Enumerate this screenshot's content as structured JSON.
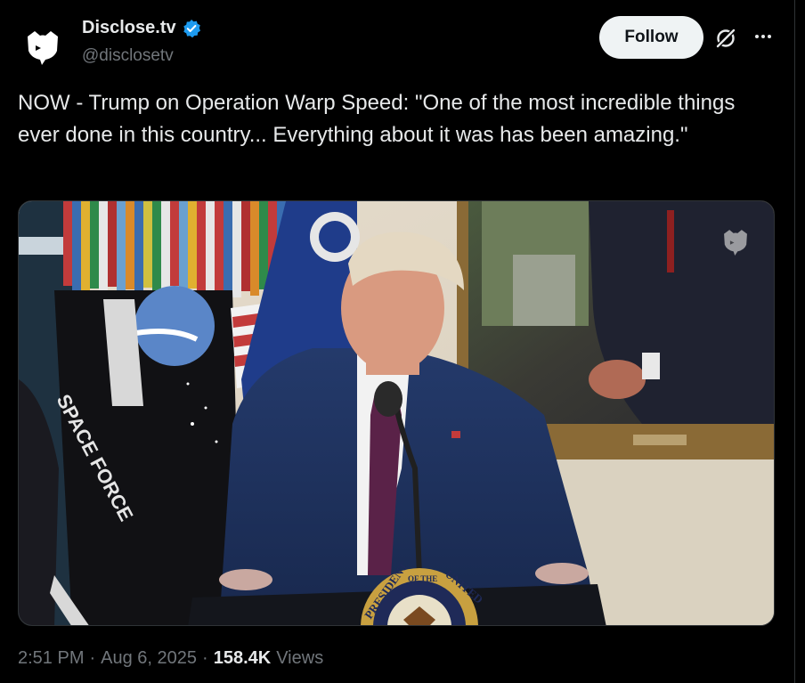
{
  "author": {
    "display_name": "Disclose.tv",
    "handle": "@disclosetv",
    "verified": true,
    "verified_color": "#1d9bf0"
  },
  "actions": {
    "follow_label": "Follow",
    "grok_icon": "grok-icon",
    "more_icon": "more-options-icon"
  },
  "tweet": {
    "text": "NOW - Trump on Operation Warp Speed: \"One of the most incredible things ever done in this country... Everything about it was has been amazing.\""
  },
  "media": {
    "type": "video-still",
    "flag_text": "SPACE FORCE",
    "seal_text_left": "PRESIDENT",
    "seal_text_mid": "OF THE",
    "seal_text_right": "UNITED"
  },
  "meta": {
    "time": "2:51 PM",
    "separator": "·",
    "date": "Aug 6, 2025",
    "views_count": "158.4K",
    "views_label": "Views"
  },
  "colors": {
    "background": "#000000",
    "text_primary": "#e7e9ea",
    "text_secondary": "#71767b",
    "follow_bg": "#eff3f4"
  }
}
